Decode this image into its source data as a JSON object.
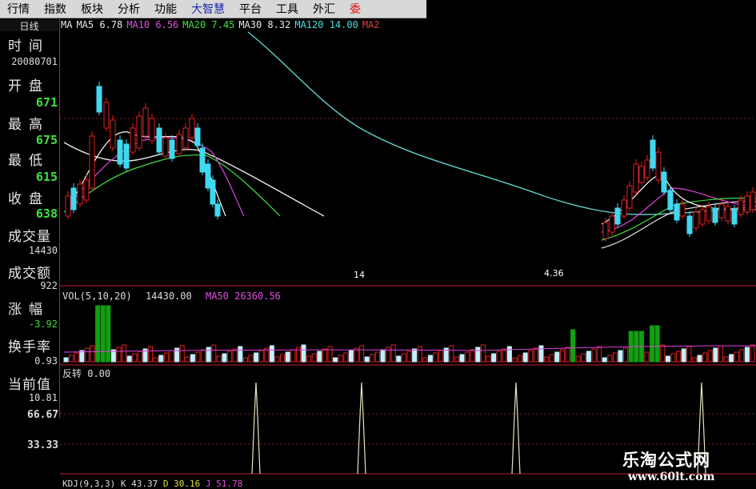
{
  "menu": [
    {
      "label": "行情",
      "style": "normal"
    },
    {
      "label": "指数",
      "style": "normal"
    },
    {
      "label": "板块",
      "style": "normal"
    },
    {
      "label": "分析",
      "style": "normal"
    },
    {
      "label": "功能",
      "style": "normal"
    },
    {
      "label": "大智慧",
      "style": "hl"
    },
    {
      "label": "平台",
      "style": "normal"
    },
    {
      "label": "工具",
      "style": "normal"
    },
    {
      "label": "外汇",
      "style": "normal"
    },
    {
      "label": "委",
      "style": "red"
    }
  ],
  "period": "日线",
  "ma_indicators": [
    {
      "text": "MA",
      "color": "#e8e8e8"
    },
    {
      "text": "MA5 6.78",
      "color": "#e8e8e8"
    },
    {
      "text": "MA10 6.56",
      "color": "#e050e0"
    },
    {
      "text": "MA20 7.45",
      "color": "#40e040"
    },
    {
      "text": "MA30 8.32",
      "color": "#e8e8e8"
    },
    {
      "text": "MA120 14.00",
      "color": "#40e0e0"
    },
    {
      "text": "MA2",
      "color": "#e04040"
    }
  ],
  "sidebar": {
    "time_label": "时间",
    "time_value": "20080701",
    "open_label": "开盘",
    "open_value": "671",
    "high_label": "最高",
    "high_value": "675",
    "low_label": "最低",
    "low_value": "615",
    "close_label": "收盘",
    "close_value": "638",
    "volume_label": "成交量",
    "volume_value": "14430",
    "amount_label": "成交额",
    "amount_value": "922",
    "change_label": "涨幅",
    "change_value": "-3.92",
    "turnover_label": "换手率",
    "turnover_value": "0.93",
    "current_label": "当前值",
    "current_value": "10.81"
  },
  "vol_panel": {
    "title": "VOL(5,10,20)",
    "value": "14430.00",
    "ma50": "MA50 26360.56"
  },
  "signal_panel": {
    "title": "反转 0.00"
  },
  "kdj_panel": {
    "title": "KDJ(9,3,3)",
    "k": "K 43.37",
    "d": "D 30.16",
    "j": "J 51.78"
  },
  "axis_labels": {
    "top": "66.67",
    "bottom": "33.33"
  },
  "price_annotations": [
    "14",
    "4.36"
  ],
  "watermark": {
    "name": "乐淘公式网",
    "url": "www.60lt.com"
  },
  "colors": {
    "up": "#e02020",
    "down": "#40d8f0",
    "vol_up": "#e02020",
    "vol_down": "#c0f0ff",
    "vol_green": "#10a010",
    "ma5": "#ffffff",
    "ma10": "#e040e0",
    "ma20": "#40e040",
    "ma30": "#e8e8e8",
    "ma120": "#60d0c8",
    "signal": "#e8e4c0",
    "grid": "#8a2020"
  }
}
